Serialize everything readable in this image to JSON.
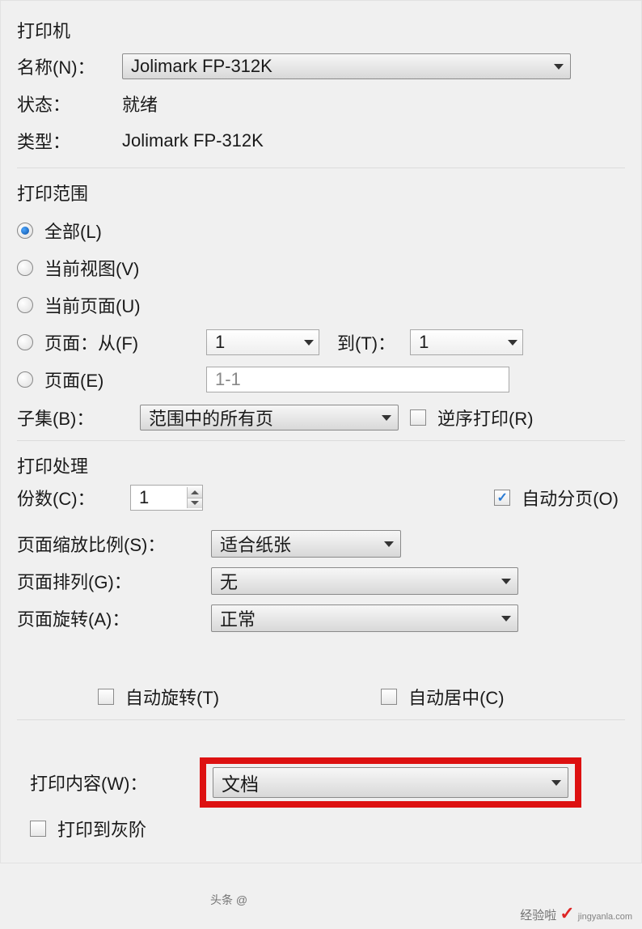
{
  "printer": {
    "title": "打印机",
    "name_label": "名称(N)：",
    "name_value": "Jolimark FP-312K",
    "status_label": "状态：",
    "status_value": "就绪",
    "type_label": "类型：",
    "type_value": "Jolimark FP-312K"
  },
  "range": {
    "title": "打印范围",
    "all": "全部(L)",
    "current_view": "当前视图(V)",
    "current_page": "当前页面(U)",
    "pages_from": "页面：从(F)",
    "from_value": "1",
    "to_label": "到(T)：",
    "to_value": "1",
    "pages_e": "页面(E)",
    "pages_e_value": "1-1",
    "subset_label": "子集(B)：",
    "subset_value": "范围中的所有页",
    "reverse": "逆序打印(R)"
  },
  "handling": {
    "title": "打印处理",
    "copies_label": "份数(C)：",
    "copies_value": "1",
    "collate": "自动分页(O)",
    "scale_label": "页面缩放比例(S)：",
    "scale_value": "适合纸张",
    "layout_label": "页面排列(G)：",
    "layout_value": "无",
    "rotate_label": "页面旋转(A)：",
    "rotate_value": "正常",
    "auto_rotate": "自动旋转(T)",
    "auto_center": "自动居中(C)"
  },
  "content": {
    "what_label": "打印内容(W)：",
    "what_value": "文档",
    "grayscale": "打印到灰阶"
  },
  "footer": {
    "brand": "经验啦",
    "mark": "✓",
    "domain": "jingyanla.com",
    "headline": "头条 @"
  }
}
